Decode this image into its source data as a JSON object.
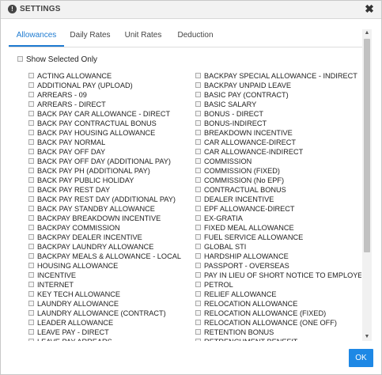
{
  "dialog": {
    "title": "SETTINGS",
    "info_icon_glyph": "!",
    "close_glyph": "✖",
    "icons": [
      "info-icon",
      "close-icon",
      "checkbox-icon"
    ]
  },
  "tabs": [
    {
      "label": "Allowances",
      "active": true
    },
    {
      "label": "Daily Rates",
      "active": false
    },
    {
      "label": "Unit Rates",
      "active": false
    },
    {
      "label": "Deduction",
      "active": false
    }
  ],
  "show_selected_label": "Show Selected Only",
  "left_items": [
    "ACTING ALLOWANCE",
    "ADDITIONAL PAY (UPLOAD)",
    "ARREARS - 09",
    "ARREARS - DIRECT",
    "BACK PAY CAR ALLOWANCE - DIRECT",
    "BACK PAY CONTRACTUAL BONUS",
    "BACK PAY HOUSING ALLOWANCE",
    "BACK PAY NORMAL",
    "BACK PAY OFF DAY",
    "BACK PAY OFF DAY (ADDITIONAL PAY)",
    "BACK PAY PH (ADDITIONAL PAY)",
    "BACK PAY PUBLIC HOLIDAY",
    "BACK PAY REST DAY",
    "BACK PAY REST DAY (ADDITIONAL PAY)",
    "BACK PAY STANDBY ALLOWANCE",
    "BACKPAY BREAKDOWN INCENTIVE",
    "BACKPAY COMMISSION",
    "BACKPAY DEALER INCENTIVE",
    "BACKPAY LAUNDRY ALLOWANCE",
    "BACKPAY MEALS & ALLOWANCE - LOCAL",
    "HOUSING ALLOWANCE",
    "INCENTIVE",
    "INTERNET",
    "KEY TECH ALLOWANCE",
    "LAUNDRY ALLOWANCE",
    "LAUNDRY ALLOWANCE (CONTRACT)",
    "LEADER ALLOWANCE",
    "LEAVE PAY - DIRECT",
    "LEAVE PAY ARREARS"
  ],
  "right_items": [
    "BACKPAY SPECIAL ALLOWANCE - INDIRECT",
    "BACKPAY UNPAID LEAVE",
    "BASIC PAY (CONTRACT)",
    "BASIC SALARY",
    "BONUS - DIRECT",
    "BONUS-INDIRECT",
    "BREAKDOWN INCENTIVE",
    "CAR ALLOWANCE-DIRECT",
    "CAR ALLOWANCE-INDIRECT",
    "COMMISSION",
    "COMMISSION (FIXED)",
    "COMMISSION (No EPF)",
    "CONTRACTUAL BONUS",
    "DEALER INCENTIVE",
    "EPF ALLOWANCE-DIRECT",
    "EX-GRATIA",
    "FIXED MEAL ALLOWANCE",
    "FUEL SERVICE ALLOWANCE",
    "GLOBAL STI",
    "HARDSHIP ALLOWANCE",
    "PASSPORT - OVERSEAS",
    "PAY IN LIEU OF SHORT NOTICE TO EMPLOYEE",
    "PETROL",
    "RELIEF ALLOWANCE",
    "RELOCATION ALLOWANCE",
    "RELOCATION ALLOWANCE (FIXED)",
    "RELOCATION ALLOWANCE (ONE OFF)",
    "RETENTION BONUS",
    "RETRENCHMENT BENEFIT"
  ],
  "ok_label": "OK",
  "colors": {
    "accent": "#1e7bd1",
    "ok_button": "#1e88e5",
    "titlebar": "#f2f2f2"
  }
}
